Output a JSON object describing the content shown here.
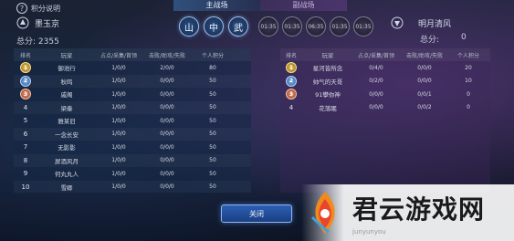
{
  "help": {
    "icon": "question-icon",
    "label": "积分说明"
  },
  "tabs": [
    {
      "label": "主战场",
      "active": true
    },
    {
      "label": "副战场",
      "active": false
    }
  ],
  "team_left": {
    "name": "墨玉京",
    "score_label": "总分:",
    "score": "2355"
  },
  "team_right": {
    "name": "明月清风",
    "score_label": "总分:",
    "score": "0"
  },
  "round_buttons": [
    "山",
    "中",
    "武"
  ],
  "timers": [
    "01:35",
    "01:35",
    "06:35",
    "01:35",
    "01:35"
  ],
  "columns": {
    "rank": "排名",
    "player": "玩家",
    "a": "占点/采集/首领",
    "b": "击败/助攻/失败",
    "c": "个人积分"
  },
  "left_rows": [
    {
      "rank": "1",
      "name": "御池行",
      "a": "1/0/0",
      "b": "2/0/0",
      "c": "80"
    },
    {
      "rank": "2",
      "name": "秋鸣",
      "a": "1/0/0",
      "b": "0/0/0",
      "c": "50"
    },
    {
      "rank": "3",
      "name": "戚阁",
      "a": "1/0/0",
      "b": "0/0/0",
      "c": "50"
    },
    {
      "rank": "4",
      "name": "梁秦",
      "a": "1/0/0",
      "b": "0/0/0",
      "c": "50"
    },
    {
      "rank": "5",
      "name": "雅某旧",
      "a": "1/0/0",
      "b": "0/0/0",
      "c": "50"
    },
    {
      "rank": "6",
      "name": "一念长安",
      "a": "1/0/0",
      "b": "0/0/0",
      "c": "50"
    },
    {
      "rank": "7",
      "name": "无影影",
      "a": "1/0/0",
      "b": "0/0/0",
      "c": "50"
    },
    {
      "rank": "8",
      "name": "屏酒风月",
      "a": "1/0/0",
      "b": "0/0/0",
      "c": "50"
    },
    {
      "rank": "9",
      "name": "何丸丸人",
      "a": "1/0/0",
      "b": "0/0/0",
      "c": "50"
    },
    {
      "rank": "10",
      "name": "雪卿",
      "a": "1/0/0",
      "b": "0/0/0",
      "c": "50"
    }
  ],
  "right_rows": [
    {
      "rank": "1",
      "name": "星河皆所念",
      "a": "0/4/0",
      "b": "0/0/0",
      "c": "20"
    },
    {
      "rank": "2",
      "name": "帅气的天哥",
      "a": "0/2/0",
      "b": "0/0/0",
      "c": "10"
    },
    {
      "rank": "3",
      "name": "91攀你神",
      "a": "0/0/0",
      "b": "0/0/1",
      "c": "0"
    },
    {
      "rank": "4",
      "name": "花落眠",
      "a": "0/0/0",
      "b": "0/0/2",
      "c": "0"
    }
  ],
  "close_label": "关闭",
  "watermark": {
    "title": "君云游戏网",
    "sub": "junyunyou"
  },
  "colors": {
    "accent": "#2c5fb5",
    "gold": "#e8c35a",
    "silver": "#7fb2e8",
    "bronze": "#e99a7a"
  }
}
